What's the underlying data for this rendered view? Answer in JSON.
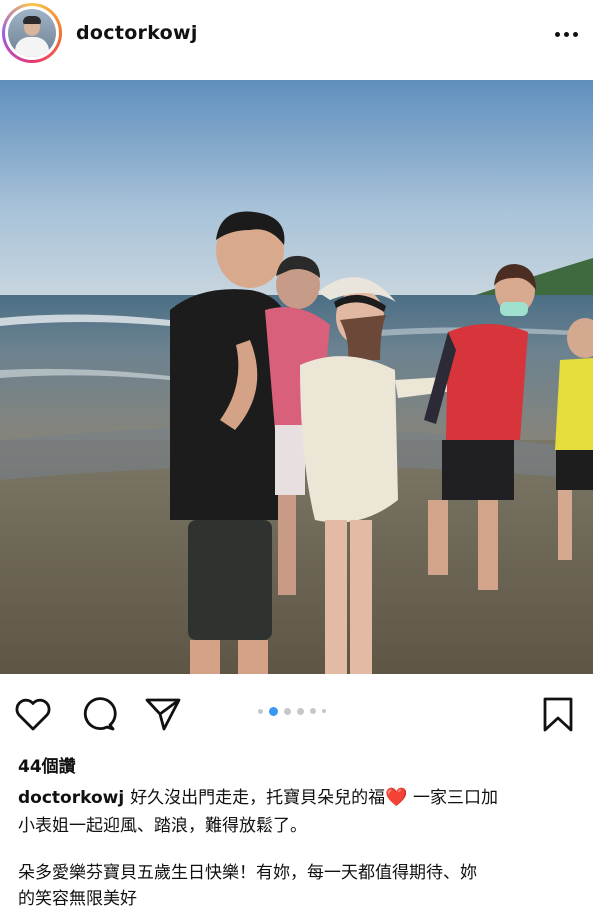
{
  "post": {
    "username": "doctorkowj",
    "likes": "44個讚",
    "caption_user": "doctorkowj",
    "caption_line1_a": "好久沒出門走走，托寶貝朵兒的福",
    "caption_line1_b": " 一家三口加",
    "caption_line2": "小表姐一起迎風、踏浪，難得放鬆了。",
    "caption_line3": "朵多愛樂芬寶貝五歲生日快樂！有妳，每一天都值得期待、妳",
    "caption_line4": "的笑容無限美好",
    "heart_emoji": "❤️"
  },
  "carousel": {
    "total": 6,
    "active": 1
  },
  "icons": {
    "more": "more-options-icon",
    "like": "heart-icon",
    "comment": "comment-icon",
    "share": "send-icon",
    "save": "bookmark-icon"
  },
  "colors": {
    "text": "#111111",
    "carousel_active": "#3897f0",
    "carousel_inactive": "#c7c7c7",
    "heart_emoji": "#e0242f"
  }
}
